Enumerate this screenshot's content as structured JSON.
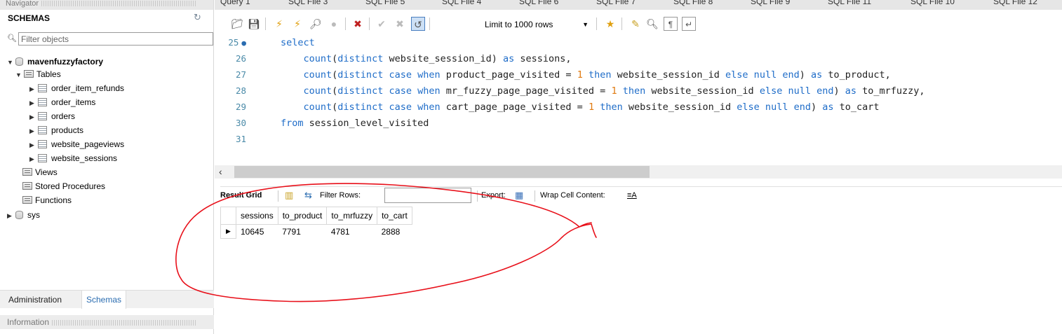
{
  "navigator": {
    "header": "Navigator",
    "schemas_title": "SCHEMAS",
    "filter_placeholder": "Filter objects",
    "tree": [
      {
        "label": "mavenfuzzyfactory",
        "kind": "schema",
        "expanded": true
      },
      {
        "label": "Tables",
        "kind": "folder",
        "expanded": true
      },
      {
        "label": "order_item_refunds",
        "kind": "table"
      },
      {
        "label": "order_items",
        "kind": "table"
      },
      {
        "label": "orders",
        "kind": "table"
      },
      {
        "label": "products",
        "kind": "table"
      },
      {
        "label": "website_pageviews",
        "kind": "table"
      },
      {
        "label": "website_sessions",
        "kind": "table"
      },
      {
        "label": "Views",
        "kind": "folder"
      },
      {
        "label": "Stored Procedures",
        "kind": "folder"
      },
      {
        "label": "Functions",
        "kind": "folder"
      },
      {
        "label": "sys",
        "kind": "schema",
        "expanded": false
      }
    ],
    "tabs": {
      "administration": "Administration",
      "schemas": "Schemas"
    },
    "info_header": "Information"
  },
  "query_tabs": [
    "Query 1",
    "SQL File 3",
    "SQL File 5",
    "SQL File 4",
    "SQL File 6",
    "SQL File 7",
    "SQL File 8",
    "SQL File 9",
    "SQL File 11",
    "SQL File 10",
    "SQL File 12"
  ],
  "toolbar": {
    "limit_label": "Limit to 1000 rows"
  },
  "editor": {
    "lines": [
      {
        "n": "25",
        "tokens": [
          {
            "t": "select",
            "k": "kw"
          }
        ]
      },
      {
        "n": "26",
        "tokens": [
          {
            "t": "    "
          },
          {
            "t": "count",
            "k": "kw"
          },
          {
            "t": "("
          },
          {
            "t": "distinct",
            "k": "kw"
          },
          {
            "t": " website_session_id) "
          },
          {
            "t": "as",
            "k": "kw"
          },
          {
            "t": " sessions,"
          }
        ]
      },
      {
        "n": "27",
        "tokens": [
          {
            "t": "    "
          },
          {
            "t": "count",
            "k": "kw"
          },
          {
            "t": "("
          },
          {
            "t": "distinct case when",
            "k": "kw"
          },
          {
            "t": " product_page_visited = "
          },
          {
            "t": "1",
            "k": "num"
          },
          {
            "t": " "
          },
          {
            "t": "then",
            "k": "kw"
          },
          {
            "t": " website_session_id "
          },
          {
            "t": "else null end",
            "k": "kw"
          },
          {
            "t": ") "
          },
          {
            "t": "as",
            "k": "kw"
          },
          {
            "t": " to_product,"
          }
        ]
      },
      {
        "n": "28",
        "tokens": [
          {
            "t": "    "
          },
          {
            "t": "count",
            "k": "kw"
          },
          {
            "t": "("
          },
          {
            "t": "distinct case when",
            "k": "kw"
          },
          {
            "t": " mr_fuzzy_page_page_visited = "
          },
          {
            "t": "1",
            "k": "num"
          },
          {
            "t": " "
          },
          {
            "t": "then",
            "k": "kw"
          },
          {
            "t": " website_session_id "
          },
          {
            "t": "else null end",
            "k": "kw"
          },
          {
            "t": ") "
          },
          {
            "t": "as",
            "k": "kw"
          },
          {
            "t": " to_mrfuzzy,"
          }
        ]
      },
      {
        "n": "29",
        "tokens": [
          {
            "t": "    "
          },
          {
            "t": "count",
            "k": "kw"
          },
          {
            "t": "("
          },
          {
            "t": "distinct case when",
            "k": "kw"
          },
          {
            "t": " cart_page_page_visited = "
          },
          {
            "t": "1",
            "k": "num"
          },
          {
            "t": " "
          },
          {
            "t": "then",
            "k": "kw"
          },
          {
            "t": " website_session_id "
          },
          {
            "t": "else null end",
            "k": "kw"
          },
          {
            "t": ") "
          },
          {
            "t": "as",
            "k": "kw"
          },
          {
            "t": " to_cart"
          }
        ]
      },
      {
        "n": "30",
        "tokens": [
          {
            "t": "from",
            "k": "kw"
          },
          {
            "t": " session_level_visited"
          }
        ]
      },
      {
        "n": "31",
        "tokens": []
      }
    ]
  },
  "result": {
    "title": "Result Grid",
    "filter_label": "Filter Rows:",
    "export_label": "Export:",
    "wrap_label": "Wrap Cell Content:",
    "columns": [
      "sessions",
      "to_product",
      "to_mrfuzzy",
      "to_cart"
    ],
    "rows": [
      [
        "10645",
        "7791",
        "4781",
        "2888"
      ]
    ]
  },
  "annotation": {
    "color": "#e8101a"
  }
}
